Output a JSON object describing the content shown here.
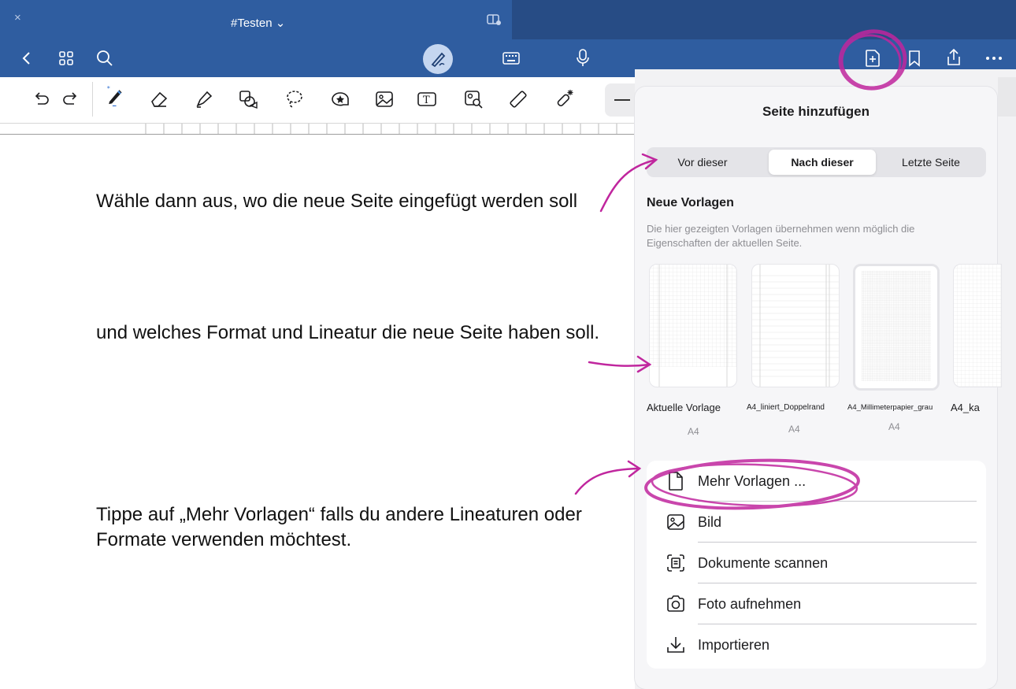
{
  "app": {
    "document_title": "#Testen ⌄",
    "close_glyph": "×",
    "nav_icons": [
      "back-chevron-icon",
      "grid-icon",
      "search-icon",
      "pen-mode-icon",
      "keyboard-icon",
      "microphone-icon",
      "add-page-icon",
      "bookmark-icon",
      "share-icon",
      "more-icon"
    ],
    "tools": [
      "undo-icon",
      "redo-icon",
      "pen-tool-icon",
      "eraser-icon",
      "highlighter-icon",
      "shapes-icon",
      "lasso-icon",
      "sticker-icon",
      "image-icon",
      "text-box-icon",
      "image-search-icon",
      "ruler-icon",
      "laser-pointer-icon"
    ],
    "accent_color": "#2f5da0",
    "highlight_color": "#c0269e"
  },
  "popover": {
    "title": "Seite hinzufügen",
    "position_options": [
      {
        "label": "Vor dieser",
        "selected": false
      },
      {
        "label": "Nach dieser",
        "selected": true
      },
      {
        "label": "Letzte Seite",
        "selected": false
      }
    ],
    "section_title": "Neue Vorlagen",
    "section_description": "Die hier gezeigten Vorlagen übernehmen wenn möglich die Eigenschaften der aktuellen Seite.",
    "templates": [
      {
        "name": "Aktuelle Vorlage",
        "size": "A4"
      },
      {
        "name": "A4_liniert_Doppelrand",
        "size": "A4"
      },
      {
        "name": "A4_Millimeterpapier_grau",
        "size": "A4"
      },
      {
        "name": "A4_ka",
        "size": ""
      }
    ],
    "actions": [
      {
        "label": "Mehr Vorlagen ...",
        "icon": "document-icon"
      },
      {
        "label": "Bild",
        "icon": "image-icon"
      },
      {
        "label": "Dokumente scannen",
        "icon": "scan-document-icon"
      },
      {
        "label": "Foto aufnehmen",
        "icon": "camera-icon"
      },
      {
        "label": "Importieren",
        "icon": "import-icon"
      }
    ]
  },
  "annotations": {
    "step1": "Wähle dann aus, wo die neue Seite eingefügt werden soll",
    "step2": "und welches Format und Lineatur die neue Seite haben soll.",
    "step3": "Tippe auf „Mehr Vorlagen“ falls du andere Lineaturen oder Formate verwenden möchtest."
  }
}
